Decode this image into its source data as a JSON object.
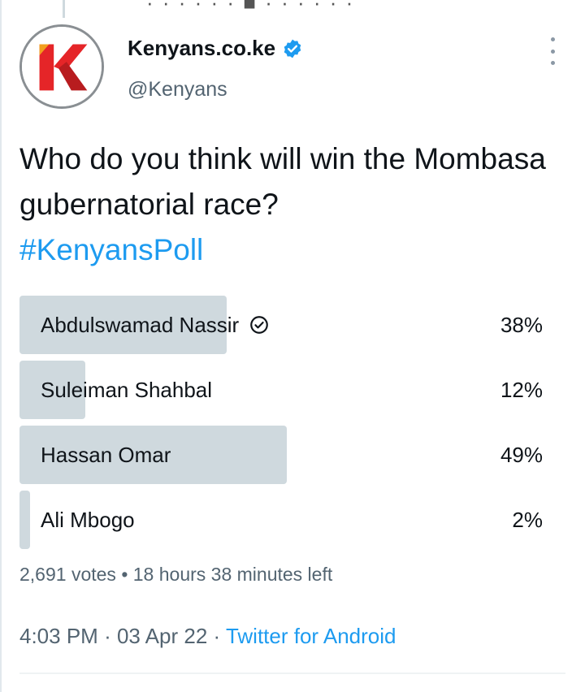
{
  "header_fragment": "· · · · · · ■ · · · · · ·",
  "tweet": {
    "display_name": "Kenyans.co.ke",
    "handle": "@Kenyans",
    "text": "Who do you think will win the Mombasa gubernatorial race?",
    "hashtag": "#KenyansPoll",
    "timestamp": "4:03 PM",
    "date": "03 Apr 22",
    "separator": "·",
    "source": "Twitter for Android"
  },
  "poll": {
    "options": [
      {
        "label": "Abdulswamad Nassir",
        "percent": "38%",
        "fill_fraction": 0.38,
        "voted": true
      },
      {
        "label": "Suleiman Shahbal",
        "percent": "12%",
        "fill_fraction": 0.12,
        "voted": false
      },
      {
        "label": "Hassan Omar",
        "percent": "49%",
        "fill_fraction": 0.49,
        "voted": false
      },
      {
        "label": "Ali Mbogo",
        "percent": "2%",
        "fill_fraction": 0.02,
        "voted": false
      }
    ],
    "votes": "2,691 votes",
    "bullet": "•",
    "time_left": "18 hours 38 minutes left"
  },
  "colors": {
    "accent": "#1d9bf0",
    "bar": "#cfd9de",
    "logo_red": "#e52528",
    "logo_dark_red": "#b81c1f",
    "logo_orange": "#f29f1d"
  },
  "icons": {
    "verified": "verified-badge-icon",
    "voted": "check-circle-icon",
    "more": "more-vertical-icon"
  }
}
